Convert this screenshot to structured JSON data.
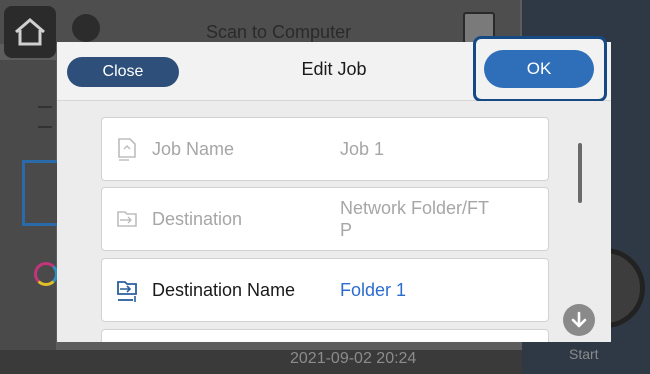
{
  "background": {
    "title": "Scan to Computer",
    "start_label": "Start",
    "datetime": "2021-09-02 20:24"
  },
  "dialog": {
    "title": "Edit Job",
    "close_label": "Close",
    "ok_label": "OK",
    "rows": [
      {
        "icon": "job-name-icon",
        "label": "Job Name",
        "value": "Job 1",
        "enabled": false
      },
      {
        "icon": "destination-icon",
        "label": "Destination",
        "value": "Network Folder/FT\nP",
        "enabled": false
      },
      {
        "icon": "destination-name-icon",
        "label": "Destination Name",
        "value": "Folder 1",
        "enabled": true
      }
    ]
  },
  "colors": {
    "accent": "#2f6fba",
    "close_button": "#2e4f7a",
    "highlight": "#174a85",
    "value_blue": "#2b6ccf"
  }
}
